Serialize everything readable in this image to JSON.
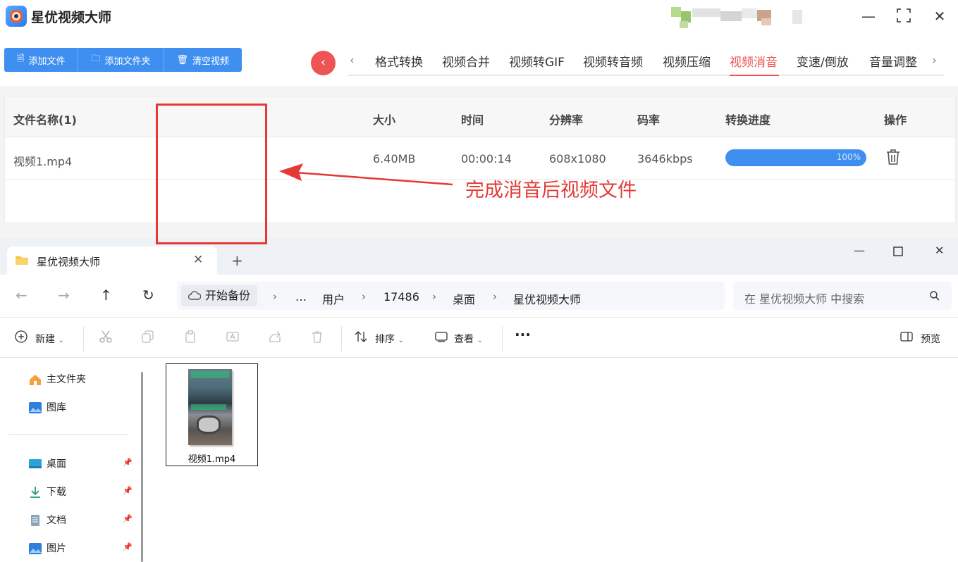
{
  "app": {
    "title": "星优视频大师",
    "buttons": {
      "add_file": "添加文件",
      "add_folder": "添加文件夹",
      "clear": "清空视频"
    },
    "tabs": [
      "格式转换",
      "视频合并",
      "视频转GIF",
      "视频转音频",
      "视频压缩",
      "视频消音",
      "变速/倒放",
      "音量调整"
    ],
    "active_tab": "视频消音",
    "table": {
      "headers": {
        "name": "文件名称(1)",
        "size": "大小",
        "time": "时间",
        "resolution": "分辨率",
        "bitrate": "码率",
        "progress": "转换进度",
        "action": "操作"
      },
      "rows": [
        {
          "name": "视频1.mp4",
          "size": "6.40MB",
          "time": "00:00:14",
          "resolution": "608x1080",
          "bitrate": "3646kbps",
          "progress_text": "100%",
          "progress": 1.0
        }
      ]
    },
    "colors": {
      "accent": "#3f8ff1",
      "active": "#ee5454"
    }
  },
  "explorer": {
    "tab_title": "星优视频大师",
    "breadcrumb": [
      "开始备份",
      "…",
      "用户",
      "17486",
      "桌面",
      "星优视频大师"
    ],
    "search_placeholder": "在 星优视频大师 中搜索",
    "commands": {
      "new": "新建",
      "sort": "排序",
      "view": "查看",
      "more": "···",
      "preview": "预览"
    },
    "sidebar": {
      "home": "主文件夹",
      "gallery": "图库",
      "desktop": "桌面",
      "downloads": "下载",
      "documents": "文档",
      "pictures": "图片"
    },
    "file": {
      "name": "视频1.mp4"
    }
  },
  "annotation": {
    "text": "完成消音后视频文件",
    "color": "#e53935"
  }
}
